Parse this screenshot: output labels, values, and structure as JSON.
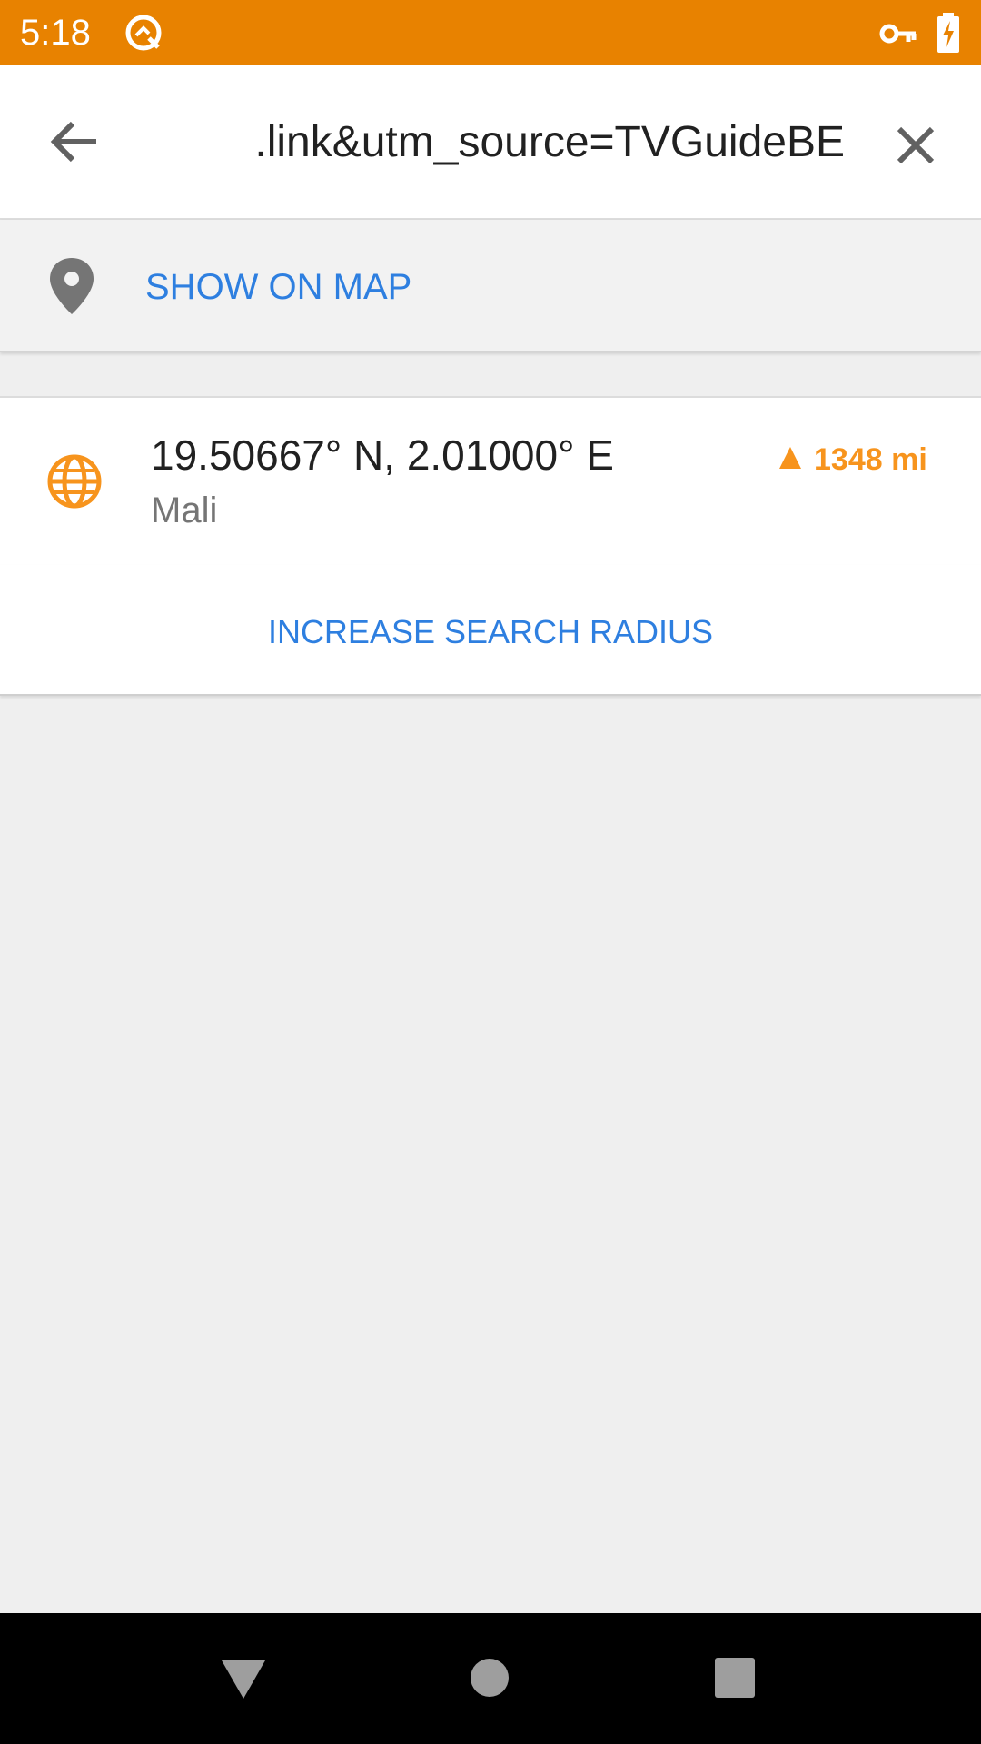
{
  "status_bar": {
    "time": "5:18",
    "background_color": "#e88200",
    "icons": [
      "app-notification-icon",
      "vpn-key-icon",
      "battery-charging-icon"
    ]
  },
  "search": {
    "query": ".link&utm_source=TVGuideBE",
    "back_icon": "arrow-back-icon",
    "clear_icon": "close-icon"
  },
  "show_on_map": {
    "icon": "location-pin-icon",
    "label": "SHOW ON MAP"
  },
  "results": [
    {
      "icon": "globe-icon",
      "title": "19.50667° N, 2.01000° E",
      "subtitle": "Mali",
      "distance": "1348 mi",
      "direction_icon": "direction-arrow-icon"
    }
  ],
  "increase_radius": {
    "label": "INCREASE SEARCH RADIUS"
  },
  "colors": {
    "accent": "#2e7fe0",
    "orange": "#f7941d",
    "status_bar": "#e88200"
  },
  "nav_bar": {
    "icons": [
      "nav-back-icon",
      "nav-home-icon",
      "nav-recents-icon"
    ]
  }
}
